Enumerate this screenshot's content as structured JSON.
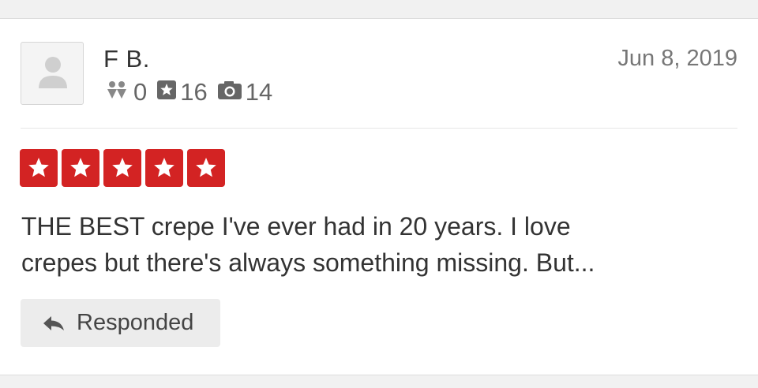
{
  "review": {
    "user": {
      "name": "F B.",
      "friends_count": "0",
      "reviews_count": "16",
      "photos_count": "14",
      "avatar_icon": "default-user-icon"
    },
    "date": "Jun 8, 2019",
    "rating": 5,
    "rating_max": 5,
    "star_color": "#d32323",
    "text_line_1": "THE BEST crepe I've ever had in 20 years. I love",
    "text_line_2": "crepes but there's always something missing. But...",
    "response_button": {
      "label": "Responded",
      "icon": "reply-arrow-icon"
    }
  },
  "icons": {
    "friends": "friends-icon",
    "reviews": "review-star-icon",
    "photos": "camera-icon"
  }
}
